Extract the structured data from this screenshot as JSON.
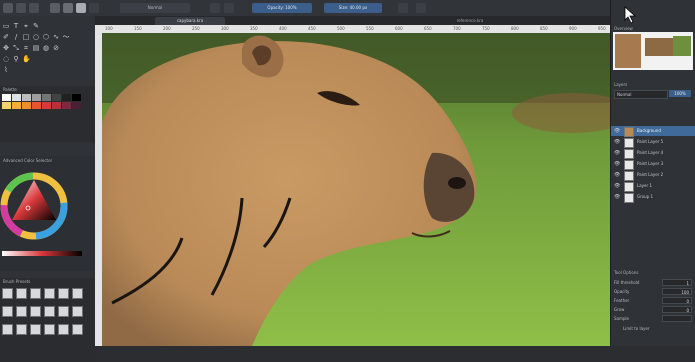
{
  "toolbar": {
    "opacity_label": "Opacity: 100%",
    "size_label": "Size: 40.00 px",
    "blend_label": "Normal",
    "icons": [
      "new-document-icon",
      "open-icon",
      "save-icon",
      "gradient-icon",
      "pattern-icon",
      "brush-preset-icon",
      "eraser-icon",
      "reload-icon",
      "mirror-icon",
      "wrap-icon",
      "play-icon"
    ]
  },
  "tabs": [
    {
      "label": "capybara.kra",
      "active": true
    },
    {
      "label": "reference.kra",
      "active": false
    }
  ],
  "ruler": {
    "ticks": [
      "100",
      "150",
      "200",
      "250",
      "300",
      "350",
      "400",
      "450",
      "500",
      "550",
      "600",
      "650",
      "700",
      "750",
      "800",
      "850",
      "900",
      "950"
    ]
  },
  "left_dock": {
    "palette_title": "Palette",
    "color_selector_title": "Advanced Color Selector",
    "brush_presets_title": "Brush Presets",
    "palette_colors": [
      "#ffffff",
      "#e0e0e0",
      "#bdbdbd",
      "#9e9e9e",
      "#757575",
      "#424242",
      "#212121",
      "#000000",
      "#f6d36b",
      "#f2b035",
      "#f28c28",
      "#e8542f",
      "#d93a36",
      "#b7313d",
      "#7f2a3c",
      "#4a1f34"
    ]
  },
  "canvas": {
    "subject": "capybara"
  },
  "right_dock": {
    "overview_title": "Overview",
    "layers_title": "Layers",
    "blend_mode": "Normal",
    "opacity": "100%",
    "layers": [
      {
        "name": "Background",
        "selected": true
      },
      {
        "name": "Paint Layer 5"
      },
      {
        "name": "Paint Layer 4"
      },
      {
        "name": "Paint Layer 3"
      },
      {
        "name": "Paint Layer 2"
      },
      {
        "name": "Layer 1"
      },
      {
        "name": "Group 1"
      }
    ],
    "tool_options_title": "Tool Options",
    "tool_options": [
      {
        "label": "Fill threshold",
        "value": "1"
      },
      {
        "label": "Opacity",
        "value": "100"
      },
      {
        "label": "Feather",
        "value": "0"
      },
      {
        "label": "Grow",
        "value": "0"
      },
      {
        "label": "Sample",
        "value": ""
      }
    ],
    "footer": "Limit to layer"
  }
}
